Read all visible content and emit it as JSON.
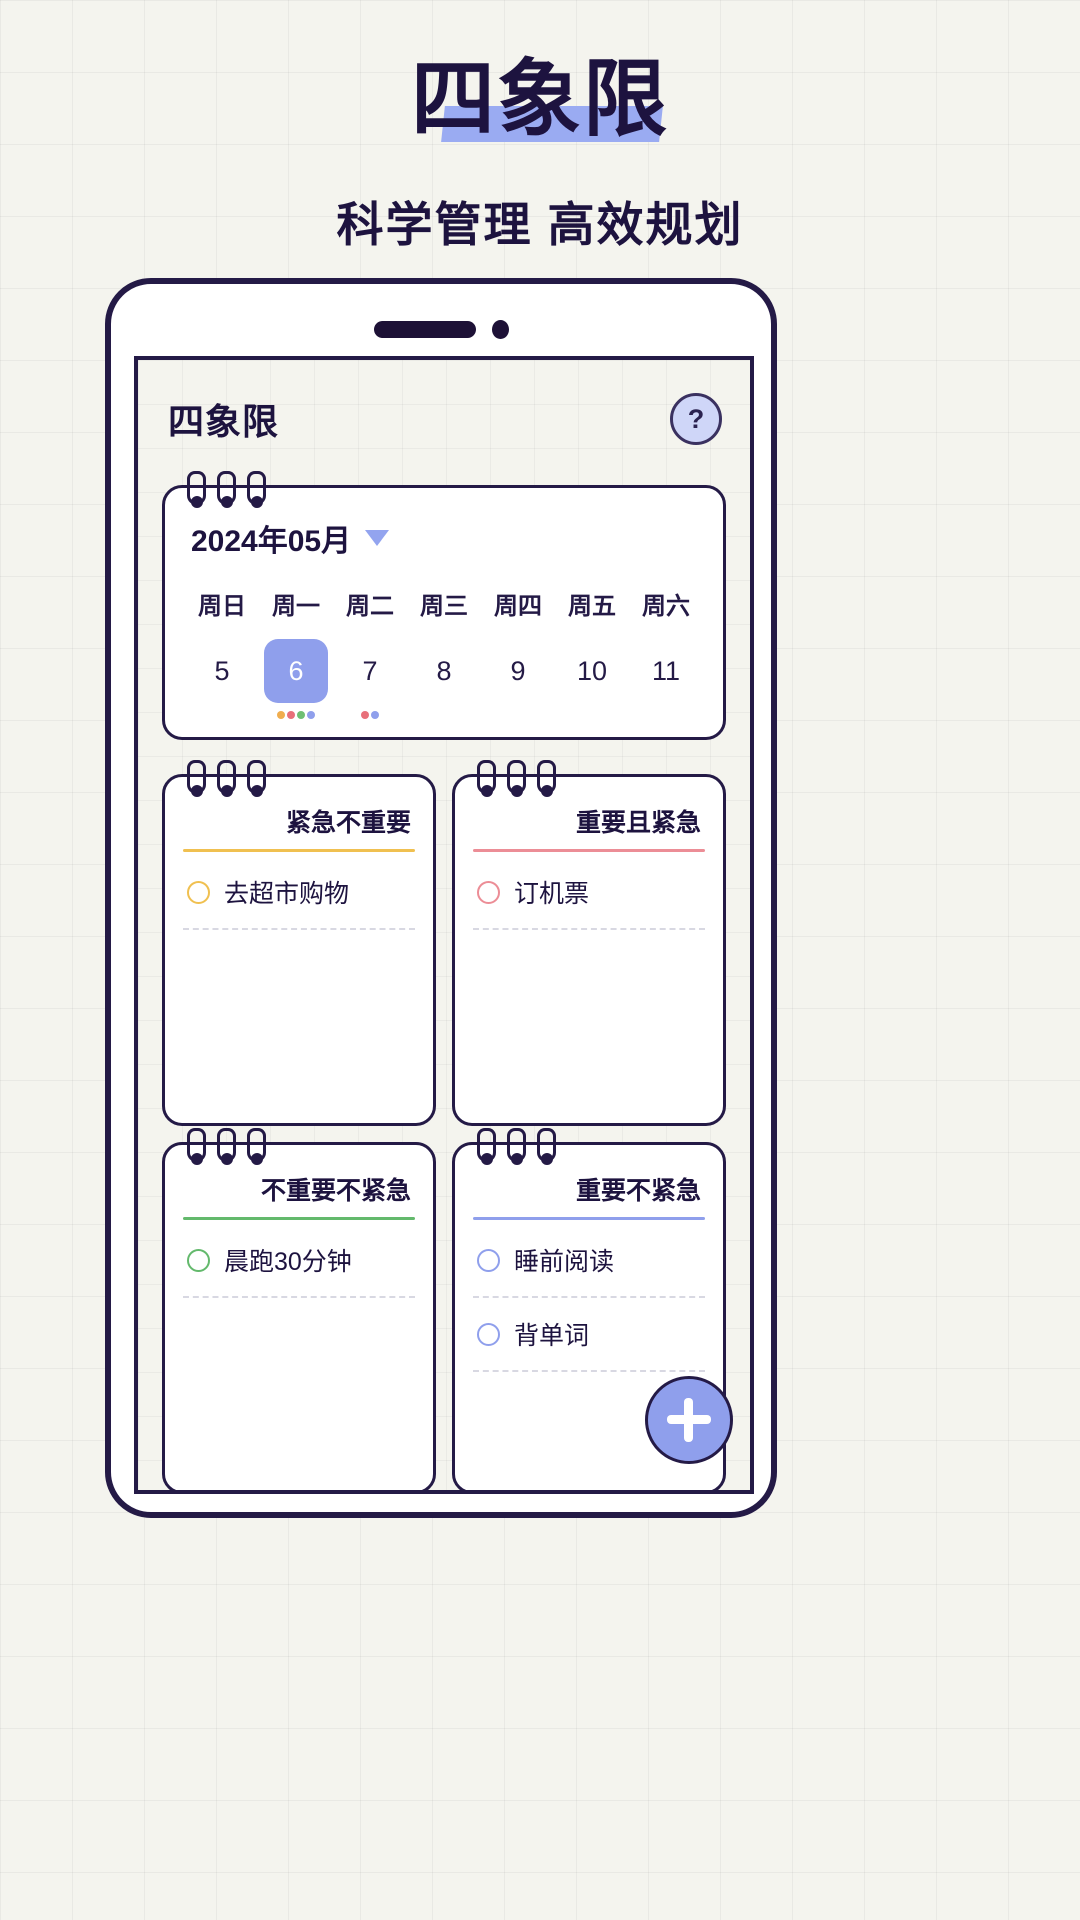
{
  "poster": {
    "title": "四象限",
    "subtitle": "科学管理 高效规划",
    "highlight_color": "#9aabf2"
  },
  "app": {
    "header": {
      "title": "四象限",
      "help_label": "?",
      "help_icon": "question-mark-icon"
    },
    "calendar": {
      "month_label": "2024年05月",
      "caret_icon": "chevron-down-icon",
      "weekdays": [
        "周日",
        "周一",
        "周二",
        "周三",
        "周四",
        "周五",
        "周六"
      ],
      "days": [
        {
          "num": "5",
          "selected": false,
          "dots": []
        },
        {
          "num": "6",
          "selected": true,
          "dots": [
            "#f0ad4e",
            "#e8707a",
            "#6fbf73",
            "#8f9fec"
          ]
        },
        {
          "num": "7",
          "selected": false,
          "dots": [
            "#e8707a",
            "#8f9fec"
          ]
        },
        {
          "num": "8",
          "selected": false,
          "dots": []
        },
        {
          "num": "9",
          "selected": false,
          "dots": []
        },
        {
          "num": "10",
          "selected": false,
          "dots": []
        },
        {
          "num": "11",
          "selected": false,
          "dots": []
        }
      ]
    },
    "quadrants": [
      {
        "title": "紧急不重要",
        "accent": "#f0c050",
        "tasks": [
          {
            "label": "去超市购物",
            "check_color": "#f0c050"
          }
        ]
      },
      {
        "title": "重要且紧急",
        "accent": "#ec8d96",
        "tasks": [
          {
            "label": "订机票",
            "check_color": "#ec8d96"
          }
        ]
      },
      {
        "title": "不重要不紧急",
        "accent": "#63b96c",
        "tasks": [
          {
            "label": "晨跑30分钟",
            "check_color": "#63b96c"
          }
        ]
      },
      {
        "title": "重要不紧急",
        "accent": "#8f9fec",
        "tasks": [
          {
            "label": "睡前阅读",
            "check_color": "#8f9fec"
          },
          {
            "label": "背单词",
            "check_color": "#8f9fec"
          }
        ]
      }
    ],
    "fab": {
      "icon": "plus-icon",
      "color": "#8f9fec"
    }
  }
}
